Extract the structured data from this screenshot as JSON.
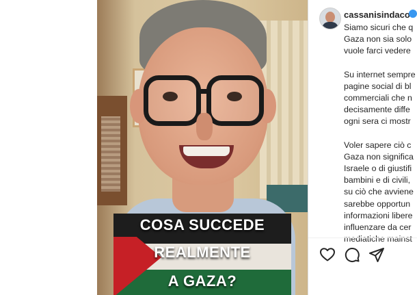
{
  "post": {
    "username": "cassanisindaco",
    "verified": true,
    "caption_paragraphs": [
      [
        "Siamo sicuri che q",
        "Gaza non sia solo",
        "vuole farci vedere"
      ],
      [
        "Su internet sempre",
        "pagine social di bl",
        "commerciali che n",
        "decisamente diffe",
        "ogni sera ci mostr"
      ],
      [
        "Voler sapere ciò c",
        "Gaza non significa",
        "Israele o di giustifi",
        "bambini e di civili,",
        "su ciò che avviene",
        "sarebbe opportun",
        "informazioni libere",
        "influenzare da cer",
        "mediatiche mainst"
      ]
    ]
  },
  "video": {
    "overlay_lines": [
      "COSA SUCCEDE",
      "REALMENTE",
      "A GAZA?"
    ]
  },
  "actions": [
    {
      "name": "like",
      "icon": "heart-icon"
    },
    {
      "name": "comment",
      "icon": "comment-icon"
    },
    {
      "name": "share",
      "icon": "share-icon"
    }
  ],
  "colors": {
    "verified": "#3897f0",
    "text": "#262626",
    "divider": "#dbdbdb"
  }
}
